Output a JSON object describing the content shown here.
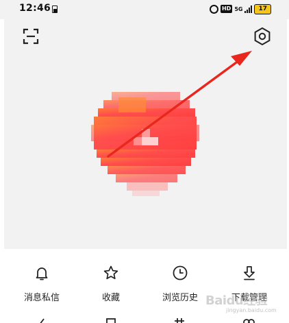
{
  "status_bar": {
    "time": "12:46",
    "network": "5G",
    "hd": "HD",
    "battery": "17"
  },
  "header": {
    "scan_icon": "scan-icon",
    "settings_icon": "settings-hexagon-icon"
  },
  "profile": {
    "avatar_colors": [
      "#ff4a4a",
      "#ff7a3a",
      "#ff5555"
    ]
  },
  "annotation": {
    "arrow_color": "#e8281e"
  },
  "menu": {
    "items": [
      {
        "label": "消息私信",
        "icon": "bell-icon"
      },
      {
        "label": "收藏",
        "icon": "star-icon"
      },
      {
        "label": "浏览历史",
        "icon": "clock-icon"
      },
      {
        "label": "下载管理",
        "icon": "download-icon"
      }
    ]
  },
  "watermark": {
    "text": "Baidu经验",
    "sub": "jingyan.baidu.com"
  }
}
